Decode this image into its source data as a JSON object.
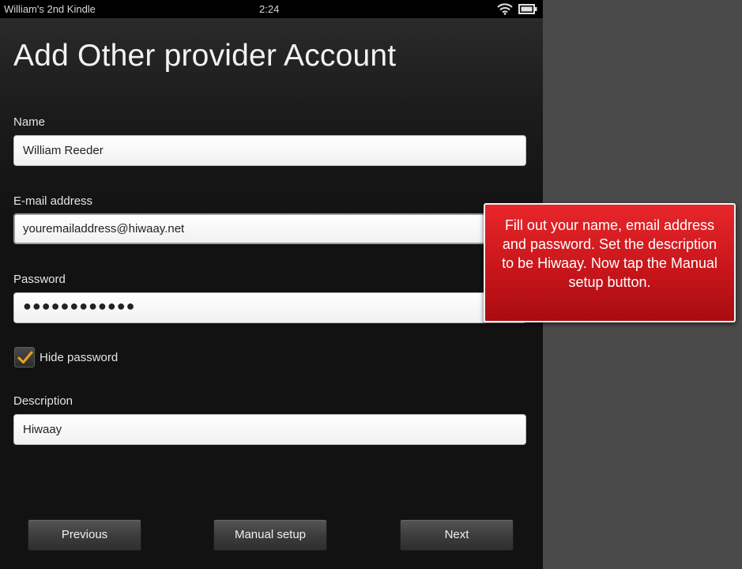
{
  "status_bar": {
    "device_name": "William's 2nd Kindle",
    "time": "2:24",
    "wifi_icon": "wifi-icon",
    "battery_icon": "battery-icon"
  },
  "page": {
    "title": "Add Other provider Account"
  },
  "form": {
    "name": {
      "label": "Name",
      "value": "William Reeder"
    },
    "email": {
      "label": "E-mail address",
      "value": "youremailaddress@hiwaay.net"
    },
    "password": {
      "label": "Password",
      "value": "●●●●●●●●●●●●"
    },
    "hide_password": {
      "label": "Hide password",
      "checked": true
    },
    "description": {
      "label": "Description",
      "value": "Hiwaay"
    }
  },
  "buttons": {
    "previous": "Previous",
    "manual_setup": "Manual setup",
    "next": "Next"
  },
  "callout": {
    "text": "Fill out your name, email address and password. Set the description to be Hiwaay. Now tap the Manual setup button."
  },
  "colors": {
    "callout_red": "#d11a1f",
    "checkmark_orange": "#f0a020",
    "background_dark": "#141414",
    "side_panel": "#4a4a4a"
  }
}
